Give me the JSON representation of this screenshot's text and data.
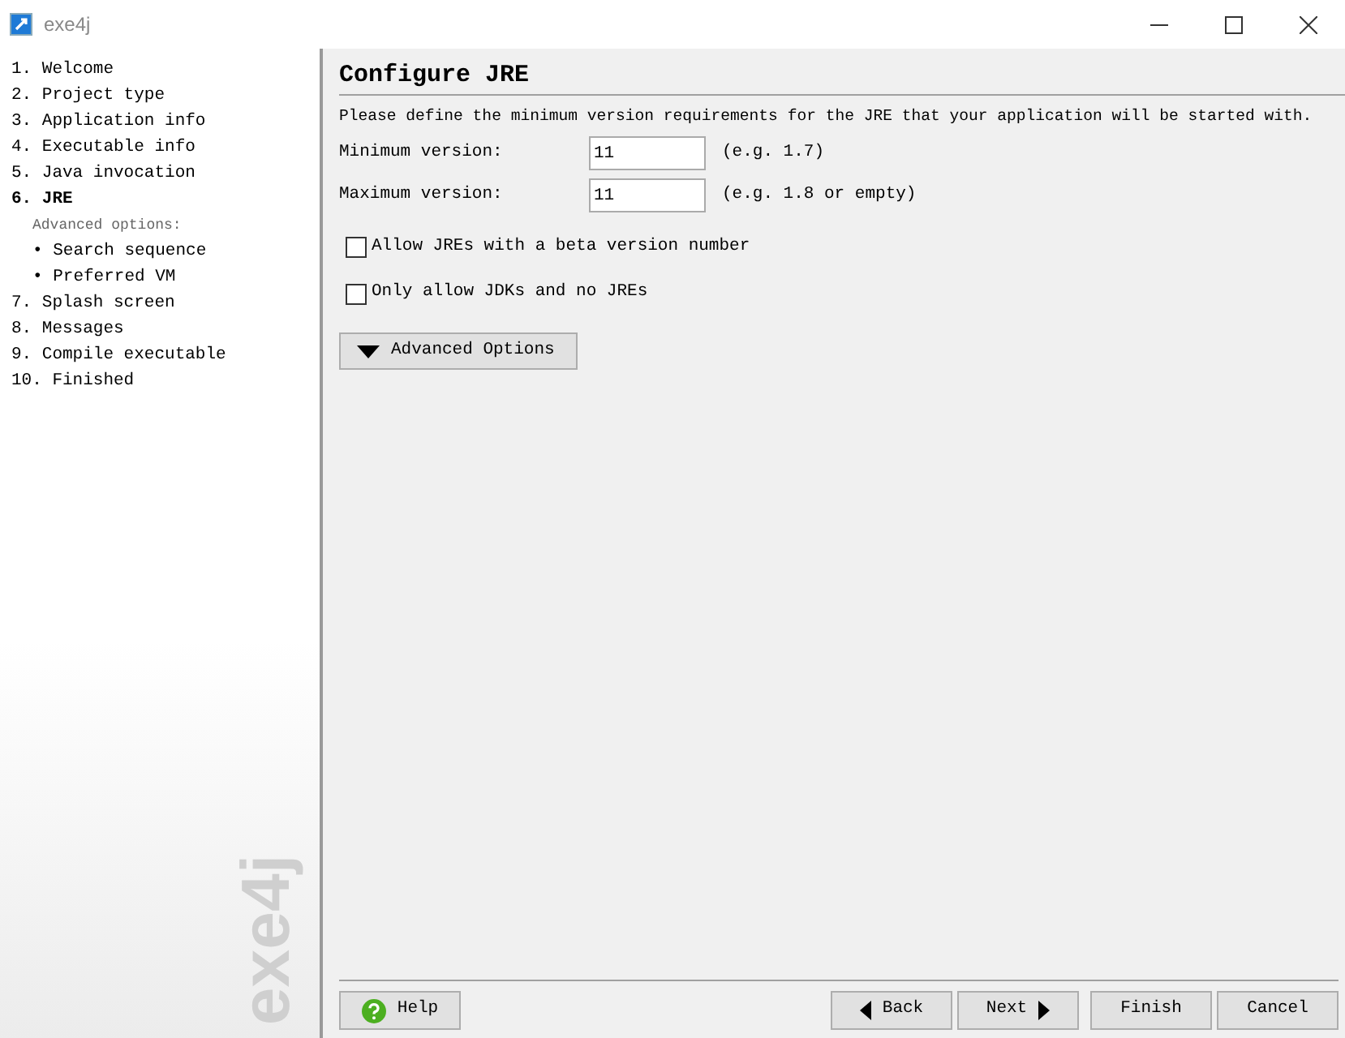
{
  "window": {
    "title": "exe4j"
  },
  "sidebar": {
    "items": [
      {
        "kind": "step",
        "label": "1. Welcome",
        "selected": false
      },
      {
        "kind": "step",
        "label": "2. Project type",
        "selected": false
      },
      {
        "kind": "step",
        "label": "3. Application info",
        "selected": false
      },
      {
        "kind": "step",
        "label": "4. Executable info",
        "selected": false
      },
      {
        "kind": "step",
        "label": "5. Java invocation",
        "selected": false
      },
      {
        "kind": "step",
        "label": "6. JRE",
        "selected": true
      },
      {
        "kind": "heading",
        "label": "Advanced options:",
        "selected": false
      },
      {
        "kind": "sub",
        "label": "• Search sequence",
        "selected": false
      },
      {
        "kind": "sub",
        "label": "• Preferred VM",
        "selected": false
      },
      {
        "kind": "step",
        "label": "7. Splash screen",
        "selected": false
      },
      {
        "kind": "step",
        "label": "8. Messages",
        "selected": false
      },
      {
        "kind": "step",
        "label": "9. Compile executable",
        "selected": false
      },
      {
        "kind": "step",
        "label": "10. Finished",
        "selected": false
      }
    ],
    "logo": "exe4j"
  },
  "page": {
    "title": "Configure JRE",
    "description": "Please define the minimum version requirements for the JRE that your application will be started with.",
    "fields": [
      {
        "label": "Minimum version:",
        "value": "11",
        "hint": "(e.g. 1.7)"
      },
      {
        "label": "Maximum version:",
        "value": "11",
        "hint": "(e.g. 1.8 or empty)"
      }
    ],
    "checkboxes": [
      {
        "label": "Allow JREs with a beta version number",
        "checked": false
      },
      {
        "label": "Only allow JDKs and no JREs",
        "checked": false
      }
    ],
    "advanced_button": "Advanced Options"
  },
  "footer": {
    "help": "Help",
    "back": "Back",
    "next": "Next",
    "finish": "Finish",
    "cancel": "Cancel"
  }
}
